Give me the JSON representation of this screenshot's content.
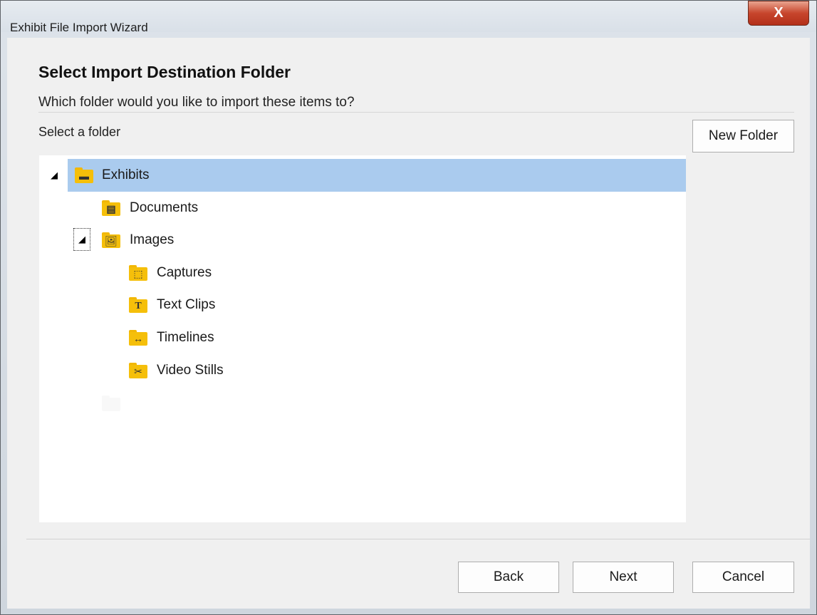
{
  "window": {
    "title": "Exhibit File Import Wizard",
    "close_label": "X"
  },
  "page": {
    "heading": "Select Import Destination Folder",
    "subheading": "Which folder would you like to import these items to?",
    "select_label": "Select a folder"
  },
  "buttons": {
    "new_folder": "New Folder",
    "back": "Back",
    "next": "Next",
    "cancel": "Cancel"
  },
  "tree": {
    "items": [
      {
        "label": "Exhibits",
        "icon": "exhibits-folder-icon",
        "expanded": true,
        "selected": true
      },
      {
        "label": "Documents",
        "icon": "documents-folder-icon"
      },
      {
        "label": "Images",
        "icon": "images-folder-icon",
        "expanded": true,
        "focused": true
      },
      {
        "label": "Captures",
        "icon": "captures-folder-icon"
      },
      {
        "label": "Text Clips",
        "icon": "text-clips-folder-icon"
      },
      {
        "label": "Timelines",
        "icon": "timelines-folder-icon"
      },
      {
        "label": "Video Stills",
        "icon": "video-stills-folder-icon"
      }
    ]
  },
  "colors": {
    "selection": "#aacbee",
    "folder": "#f5bf0a",
    "close_button": "#c7452c"
  }
}
